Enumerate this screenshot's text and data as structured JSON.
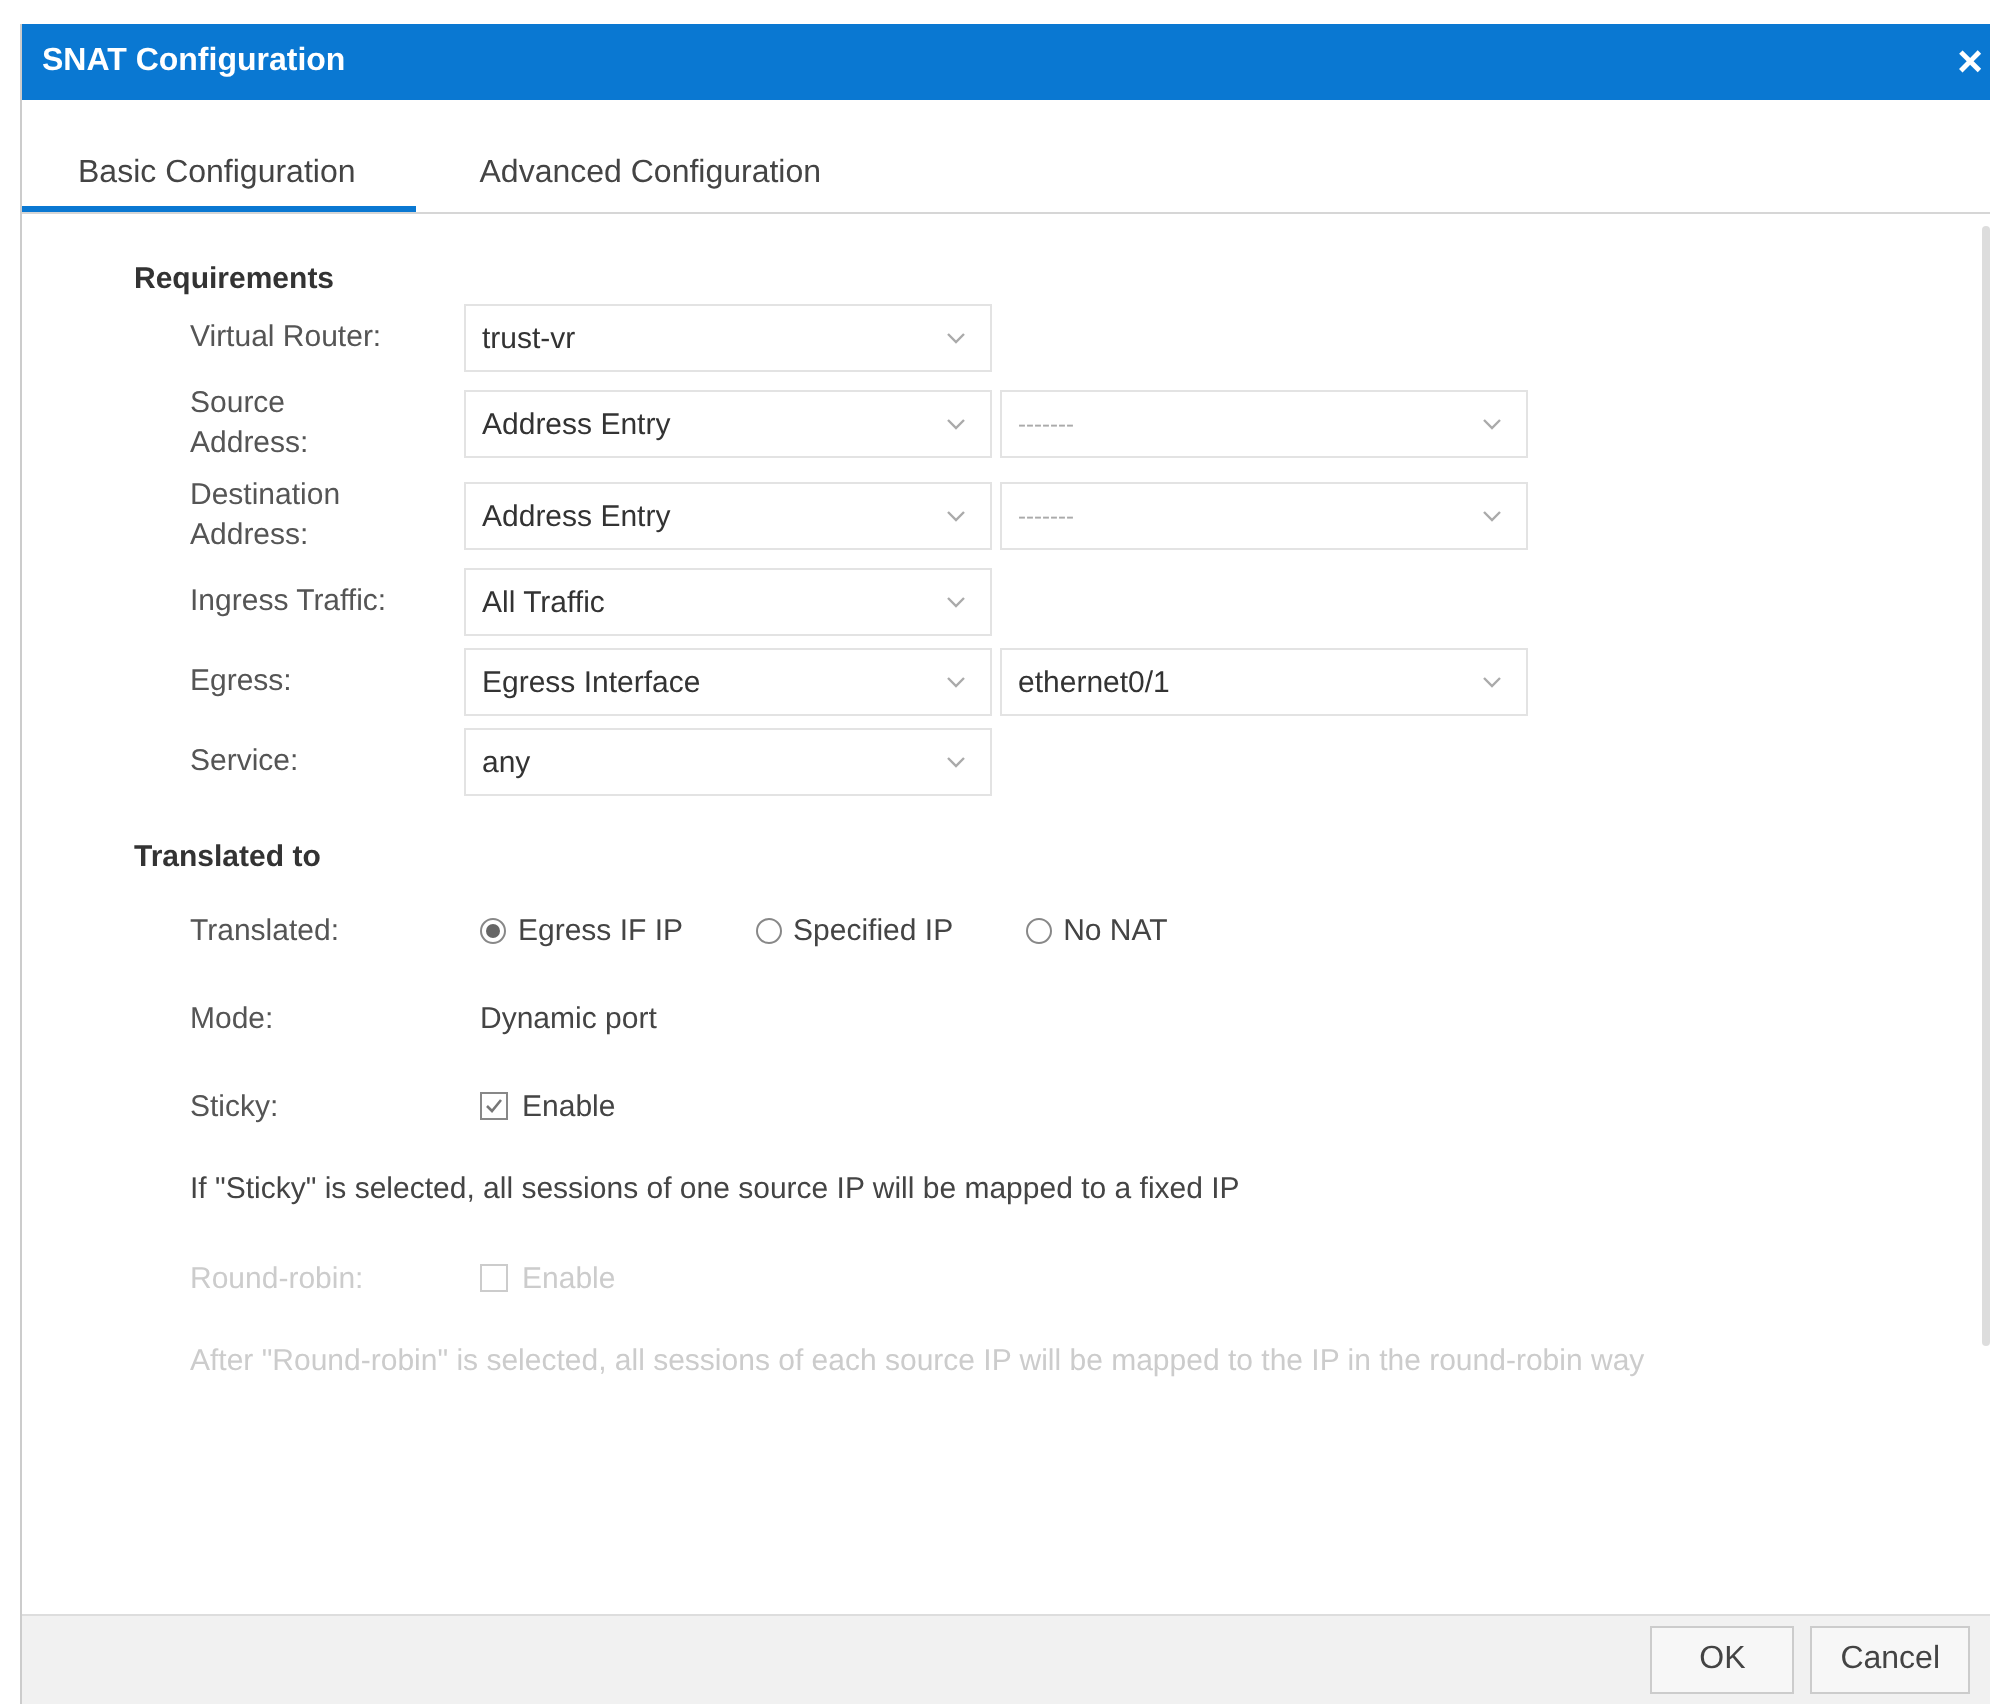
{
  "window": {
    "title": "SNAT Configuration",
    "close": "×"
  },
  "tabs": [
    {
      "label": "Basic Configuration",
      "selected": true
    },
    {
      "label": "Advanced Configuration",
      "selected": false
    }
  ],
  "requirements": {
    "title": "Requirements",
    "rows": [
      {
        "label": "Virtual Router:",
        "selects": [
          {
            "value": "trust-vr"
          }
        ]
      },
      {
        "label": "Source Address:",
        "selects": [
          {
            "value": "Address Entry"
          },
          {
            "placeholder": "-------"
          }
        ]
      },
      {
        "label": "Destination Address:",
        "selects": [
          {
            "value": "Address Entry"
          },
          {
            "placeholder": "-------"
          }
        ]
      },
      {
        "label": "Ingress Traffic:",
        "selects": [
          {
            "value": "All Traffic"
          }
        ]
      },
      {
        "label": "Egress:",
        "selects": [
          {
            "value": "Egress Interface"
          },
          {
            "value": "ethernet0/1"
          }
        ]
      },
      {
        "label": "Service:",
        "selects": [
          {
            "value": "any"
          }
        ]
      }
    ]
  },
  "translated": {
    "title": "Translated to",
    "rows": [
      {
        "kind": "radio",
        "label": "Translated:",
        "options": [
          {
            "label": "Egress IF IP",
            "selected": true
          },
          {
            "label": "Specified IP",
            "selected": false
          },
          {
            "label": "No NAT",
            "selected": false
          }
        ]
      },
      {
        "kind": "text",
        "label": "Mode:",
        "value": "Dynamic port"
      },
      {
        "kind": "checkbox",
        "label": "Sticky:",
        "option": "Enable",
        "checked": true,
        "disabled": false
      },
      {
        "kind": "note",
        "text": "If \"Sticky\" is selected, all sessions of one source IP will be mapped to a fixed IP",
        "disabled": false
      },
      {
        "kind": "checkbox",
        "label": "Round-robin:",
        "option": "Enable",
        "checked": false,
        "disabled": true
      },
      {
        "kind": "note",
        "text": "After \"Round-robin\" is selected, all sessions of each source IP will be mapped to the IP in the round-robin way",
        "disabled": true
      }
    ]
  },
  "buttons": [
    "OK",
    "Cancel"
  ]
}
